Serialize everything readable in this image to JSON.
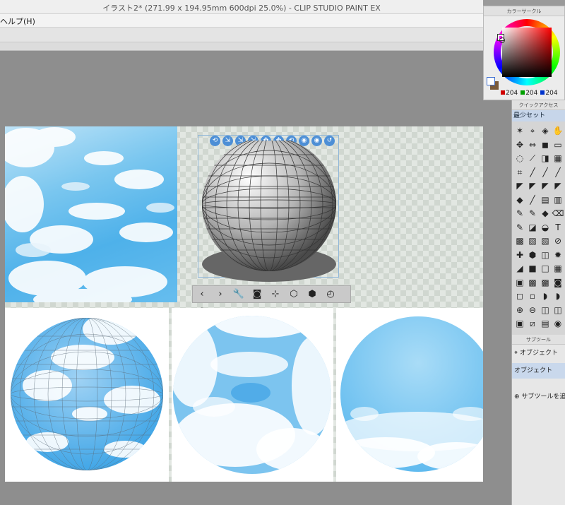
{
  "window": {
    "title": "イラスト2* (271.99 x 194.95mm 600dpi 25.0%)  - CLIP STUDIO PAINT EX"
  },
  "menu": {
    "help": "ヘルプ(H)"
  },
  "color_panel": {
    "title": "カラーサークル",
    "r": "204",
    "g": "204",
    "b": "204",
    "colors": {
      "r": "#d00000",
      "g": "#00a000",
      "b": "#0033cc"
    }
  },
  "quick_access": {
    "title": "クイックアクセス",
    "set_name": "最少セット",
    "tools": [
      [
        "✶",
        "⌖",
        "◈",
        "✋"
      ],
      [
        "✥",
        "⇔",
        "◼",
        "▭"
      ],
      [
        "◌",
        "⟋",
        "◨",
        "▦"
      ],
      [
        "⌗",
        "╱",
        "╱",
        "╱"
      ],
      [
        "◤",
        "◤",
        "◤",
        "◤"
      ],
      [
        "◆",
        "╱",
        "▤",
        "▥"
      ],
      [
        "✎",
        "✎",
        "◆",
        "⌫"
      ],
      [
        "✎",
        "◪",
        "◒",
        "T"
      ],
      [
        "▩",
        "▨",
        "▧",
        "⊘"
      ],
      [
        "✚",
        "⬢",
        "◫",
        "✹"
      ],
      [
        "◢",
        "■",
        "□",
        "▦"
      ],
      [
        "▣",
        "▩",
        "▩",
        "◙"
      ],
      [
        "◻",
        "▫",
        "◗",
        "◗"
      ],
      [
        "⊕",
        "⊖",
        "◫",
        "◫"
      ],
      [
        "▣",
        "⧄",
        "▤",
        "◉"
      ]
    ]
  },
  "subtool": {
    "title": "サブツール",
    "item1": "オブジェクト",
    "item2": "オブジェクト",
    "add": "サブツールを追加す"
  },
  "canvas_tools": {
    "object_icons": [
      "⟲",
      "⇲",
      "⇲",
      "⇲",
      "✥",
      "✥",
      "⟲",
      "◉",
      "◉",
      "↺"
    ],
    "bottom_icons": [
      "‹",
      "›",
      "🔧",
      "◙",
      "⊹",
      "⬡",
      "⬢",
      "◴",
      "⊛"
    ]
  }
}
